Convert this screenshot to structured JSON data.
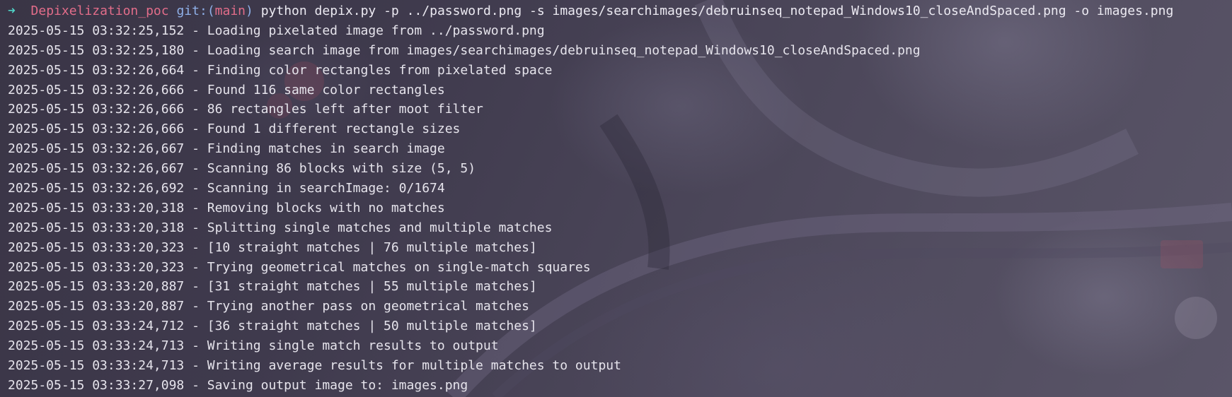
{
  "theme": {
    "arrow_color": "#4fd1c5",
    "dir_color": "#e26d8a",
    "git_color": "#8fb0e8",
    "text_color": "#e6e4ec"
  },
  "prompt": {
    "arrow": "➜",
    "directory": "Depixelization_poc",
    "git_label": "git:",
    "git_open": "(",
    "branch": "main",
    "git_close": ")",
    "command": "python depix.py -p ../password.png -s images/searchimages/debruinseq_notepad_Windows10_closeAndSpaced.png -o images.png"
  },
  "log_lines": [
    "2025-05-15 03:32:25,152 - Loading pixelated image from ../password.png",
    "2025-05-15 03:32:25,180 - Loading search image from images/searchimages/debruinseq_notepad_Windows10_closeAndSpaced.png",
    "2025-05-15 03:32:26,664 - Finding color rectangles from pixelated space",
    "2025-05-15 03:32:26,666 - Found 116 same color rectangles",
    "2025-05-15 03:32:26,666 - 86 rectangles left after moot filter",
    "2025-05-15 03:32:26,666 - Found 1 different rectangle sizes",
    "2025-05-15 03:32:26,667 - Finding matches in search image",
    "2025-05-15 03:32:26,667 - Scanning 86 blocks with size (5, 5)",
    "2025-05-15 03:32:26,692 - Scanning in searchImage: 0/1674",
    "2025-05-15 03:33:20,318 - Removing blocks with no matches",
    "2025-05-15 03:33:20,318 - Splitting single matches and multiple matches",
    "2025-05-15 03:33:20,323 - [10 straight matches | 76 multiple matches]",
    "2025-05-15 03:33:20,323 - Trying geometrical matches on single-match squares",
    "2025-05-15 03:33:20,887 - [31 straight matches | 55 multiple matches]",
    "2025-05-15 03:33:20,887 - Trying another pass on geometrical matches",
    "2025-05-15 03:33:24,712 - [36 straight matches | 50 multiple matches]",
    "2025-05-15 03:33:24,713 - Writing single match results to output",
    "2025-05-15 03:33:24,713 - Writing average results for multiple matches to output",
    "2025-05-15 03:33:27,098 - Saving output image to: images.png"
  ]
}
